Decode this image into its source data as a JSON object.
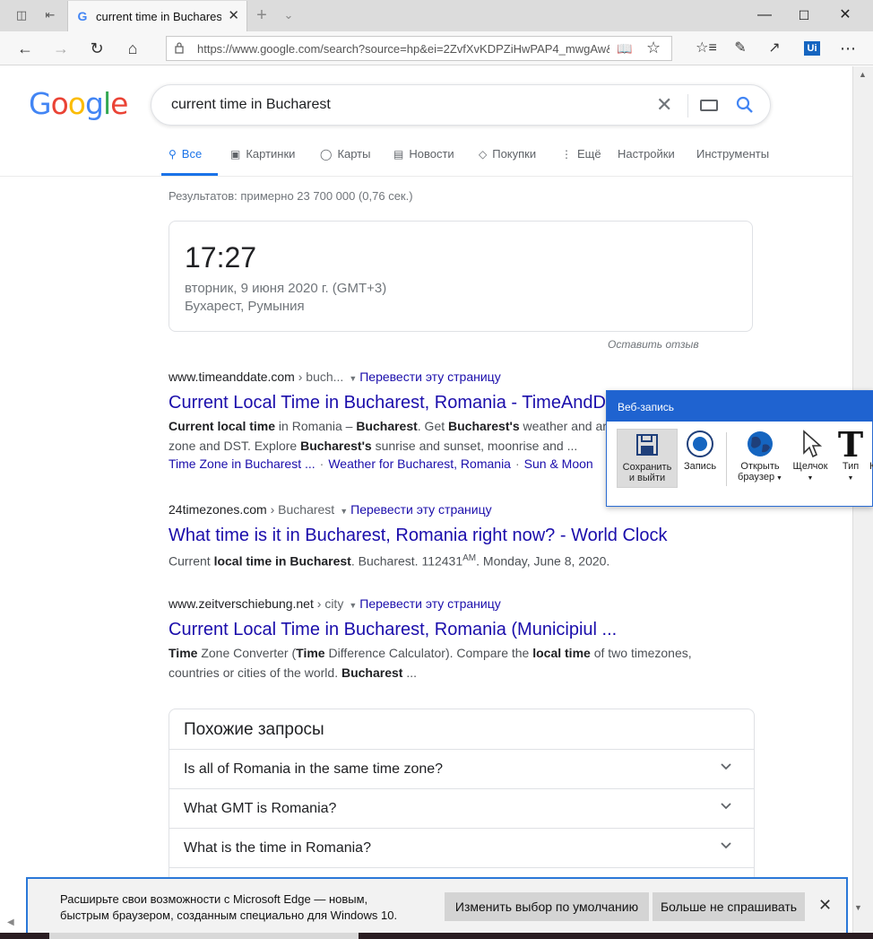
{
  "browser": {
    "tab_title": "current time in Bucharest",
    "url": "https://www.google.com/search?source=hp&ei=2ZvfXvKDPZiHwPAP4_mwgAw&",
    "extension_label": "Ui"
  },
  "google": {
    "logo": [
      "G",
      "o",
      "o",
      "g",
      "l",
      "e"
    ],
    "logo_colors": [
      "#4285f4",
      "#ea4335",
      "#fbbc05",
      "#4285f4",
      "#34a853",
      "#ea4335"
    ],
    "query": "current time in Bucharest",
    "tabs": [
      {
        "label": "Все",
        "icon": "search-icon"
      },
      {
        "label": "Картинки",
        "icon": "image-icon"
      },
      {
        "label": "Карты",
        "icon": "map-pin-icon"
      },
      {
        "label": "Новости",
        "icon": "news-icon"
      },
      {
        "label": "Покупки",
        "icon": "tag-icon"
      },
      {
        "label": "Ещё",
        "icon": "more-icon"
      },
      {
        "label": "Настройки"
      },
      {
        "label": "Инструменты"
      }
    ],
    "stats": "Результатов: примерно 23 700 000 (0,76 сек.)",
    "clock": {
      "time": "17:27",
      "date": "вторник, 9 июня 2020 г. (GMT+3)",
      "location": "Бухарест, Румыния"
    },
    "feedback": "Оставить отзыв",
    "translate_label": "Перевести эту страницу",
    "results": [
      {
        "domain": "www.timeanddate.com",
        "breadcrumb": " › buch...",
        "title": "Current Local Time in Bucharest, Romania - TimeAndD",
        "snippet_line1": {
          "b1": "Current local time",
          "t1": " in Romania – ",
          "b2": "Bucharest",
          "t2": ". Get ",
          "b3": "Bucharest's",
          "t3": " weather and ar"
        },
        "snippet_line2": {
          "t1": "zone and DST. Explore ",
          "b1": "Bucharest's",
          "t2": " sunrise and sunset, moonrise and ..."
        },
        "sitelinks": [
          "Time Zone in Bucharest ...",
          "Weather for Bucharest, Romania",
          "Sun & Moon"
        ]
      },
      {
        "domain": "24timezones.com",
        "breadcrumb": " › Bucharest",
        "title": "What time is it in Bucharest, Romania right now? - World Clock",
        "snippet": {
          "t1": "Current ",
          "b1": "local time in Bucharest",
          "t2": ". Bucharest. 112431",
          "sup": "AM",
          "t3": ". Monday, June 8, 2020."
        }
      },
      {
        "domain": "www.zeitverschiebung.net",
        "breadcrumb": " › city",
        "title": "Current Local Time in Bucharest, Romania (Municipiul ...",
        "snippet_line1": {
          "b1": "Time",
          "t1": " Zone Converter (",
          "b2": "Time",
          "t2": " Difference Calculator). Compare the ",
          "b3": "local time",
          "t3": " of two timezones,"
        },
        "snippet_line2": {
          "t1": "countries or cities of the world. ",
          "b1": "Bucharest",
          "t2": " ..."
        }
      }
    ],
    "related": {
      "heading": "Похожие запросы",
      "questions": [
        "Is all of Romania in the same time zone?",
        "What GMT is Romania?",
        "What is the time in Romania?"
      ]
    }
  },
  "recorder": {
    "title": "Веб-запись",
    "buttons": {
      "save_line1": "Сохранить",
      "save_line2": "и выйти",
      "record": "Запись",
      "open_line1": "Открыть",
      "open_line2": "браузер",
      "click": "Щелчок",
      "type": "Тип",
      "next_partial": "К"
    }
  },
  "notification": {
    "line1": "Расширьте свои возможности с Microsoft Edge — новым,",
    "line2": "быстрым браузером, созданным специально для Windows 10.",
    "btn_default": "Изменить выбор по умолчанию",
    "btn_never": "Больше не спрашивать"
  }
}
